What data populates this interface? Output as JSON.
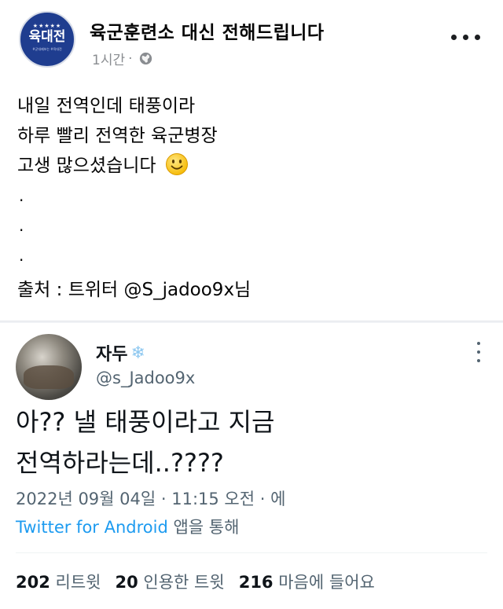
{
  "post": {
    "page_name": "육군훈련소 대신 전해드립니다",
    "avatar": {
      "stars": "★★★★★",
      "text": "육대전",
      "subtext": "#군대제보는 #육대전"
    },
    "time": "1시간",
    "separator": "·",
    "body_lines": [
      "내일 전역인데 태풍이라",
      "하루 빨리 전역한 육군병장",
      "고생 많으셨습니다"
    ],
    "dots": [
      ".",
      ".",
      "."
    ],
    "source": "출처 : 트위터 @S_jadoo9x님"
  },
  "tweet": {
    "display_name": "자두",
    "name_emoji": "❄",
    "handle": "@s_Jadoo9x",
    "text_lines": [
      "아?? 낼 태풍이라고 지금",
      "전역하라는데..????"
    ],
    "timestamp": "2022년 09월 04일 · 11:15 오전 · 에",
    "source_link": "Twitter for Android",
    "source_suffix": " 앱을 통해",
    "stats": [
      {
        "num": "202",
        "label": "리트윗"
      },
      {
        "num": "20",
        "label": "인용한 트윗"
      },
      {
        "num": "216",
        "label": "마음에 들어요"
      }
    ]
  },
  "colors": {
    "avatar_bg": "#1f3d8f",
    "link_blue": "#1d9bf0",
    "meta_gray": "#8a8d91",
    "tweet_gray": "#536471"
  },
  "icons": [
    "globe-icon",
    "more-icon",
    "smile-emoji",
    "snowflake-icon",
    "tweet-more-icon"
  ]
}
